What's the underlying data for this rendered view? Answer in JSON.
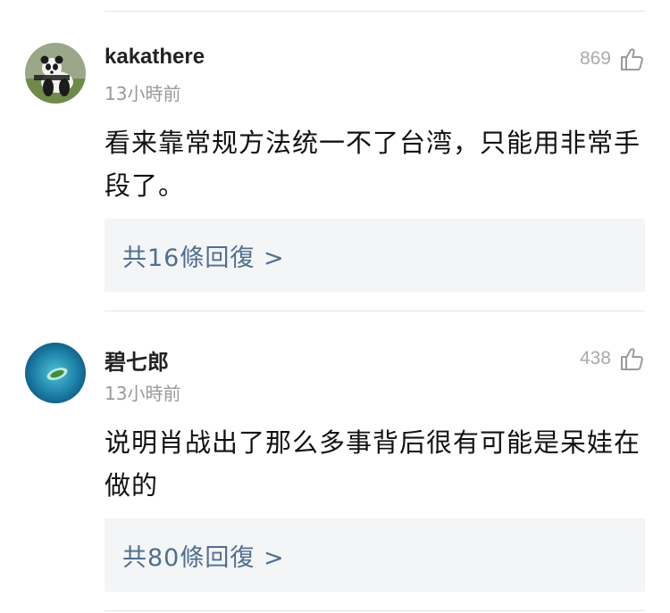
{
  "comments": [
    {
      "username": "kakathere",
      "time": "13小時前",
      "likes": "869",
      "content": "看来靠常规方法统一不了台湾，只能用非常手段了。",
      "replies_label": "共16條回復 >",
      "avatar_icon": "panda-avatar"
    },
    {
      "username": "碧七郎",
      "time": "13小時前",
      "likes": "438",
      "content": "说明肖战出了那么多事背后很有可能是呆娃在做的",
      "replies_label": "共80條回復 >",
      "avatar_icon": "island-avatar"
    }
  ],
  "colors": {
    "reply_text": "#4f6f8f",
    "reply_bg": "#f4f5f7",
    "muted": "#999999"
  }
}
